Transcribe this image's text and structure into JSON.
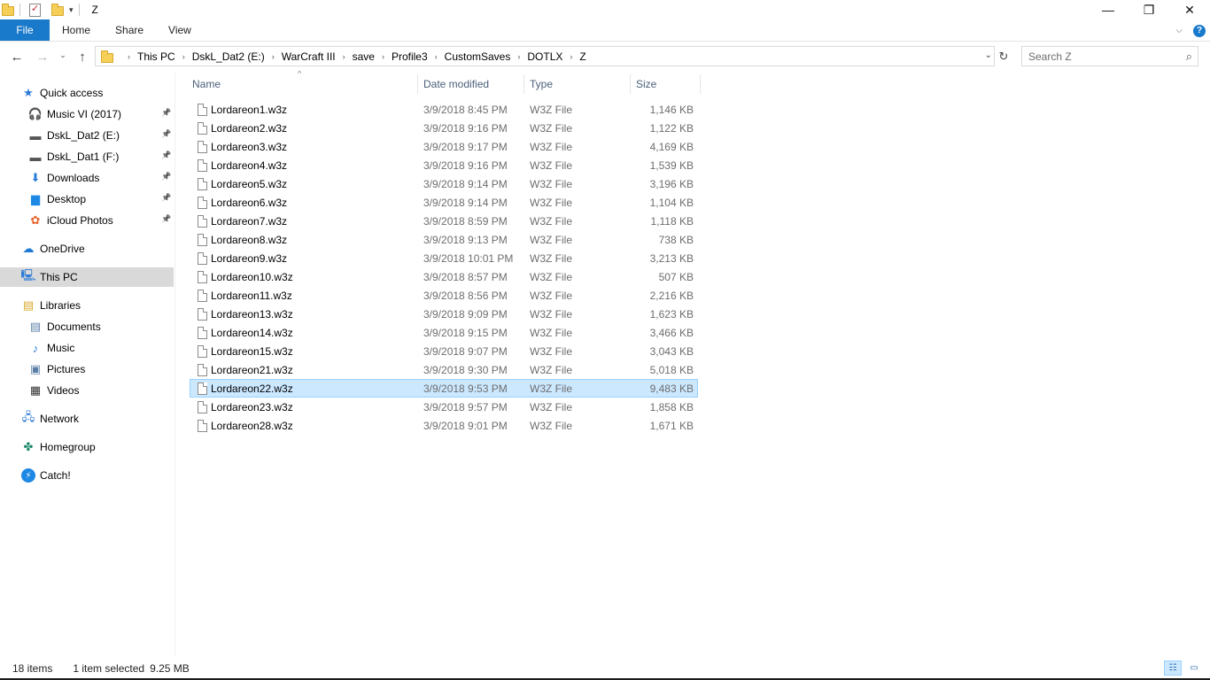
{
  "window": {
    "title": "Z",
    "minimize_glyph": "—",
    "maximize_glyph": "❐",
    "close_glyph": "✕"
  },
  "ribbon": {
    "tabs": [
      "File",
      "Home",
      "Share",
      "View"
    ],
    "expand_glyph": "⌵",
    "help_glyph": "?"
  },
  "navigation": {
    "back_glyph": "←",
    "forward_glyph": "→",
    "recent_glyph": "⌄",
    "up_glyph": "↑",
    "refresh_glyph": "↻",
    "dropdown_glyph": "⌄",
    "breadcrumbs": [
      "This PC",
      "DskL_Dat2 (E:)",
      "WarCraft III",
      "save",
      "Profile3",
      "CustomSaves",
      "DOTLX",
      "Z"
    ],
    "search_placeholder": "Search Z",
    "search_icon": "magnifier-icon"
  },
  "sidebar": {
    "items": [
      {
        "label": "Quick access",
        "icon": "star-icon",
        "glyph": "★",
        "color": "#2d7bd8"
      },
      {
        "label": "Music VI (2017)",
        "icon": "headphones-icon",
        "glyph": "🎧",
        "color": "#d2245a",
        "pinned": true
      },
      {
        "label": "DskL_Dat2 (E:)",
        "icon": "drive-icon",
        "glyph": "▬",
        "color": "#555555",
        "pinned": true
      },
      {
        "label": "DskL_Dat1 (F:)",
        "icon": "drive-icon",
        "glyph": "▬",
        "color": "#555555",
        "pinned": true
      },
      {
        "label": "Downloads",
        "icon": "download-arrow-icon",
        "glyph": "⬇",
        "color": "#2d7bd8",
        "pinned": true
      },
      {
        "label": "Desktop",
        "icon": "desktop-icon",
        "glyph": "▆",
        "color": "#1e88e5",
        "pinned": true
      },
      {
        "label": "iCloud Photos",
        "icon": "photos-icon",
        "glyph": "✿",
        "color": "#e8622c",
        "pinned": true
      },
      {
        "label": "OneDrive",
        "icon": "cloud-icon",
        "glyph": "☁",
        "color": "#1d78d6"
      },
      {
        "label": "This PC",
        "icon": "computer-icon",
        "glyph": "🖳",
        "color": "#2d7bd8",
        "selected": true
      },
      {
        "label": "Libraries",
        "icon": "libraries-icon",
        "glyph": "▤",
        "color": "#d9a92d"
      },
      {
        "label": "Documents",
        "icon": "documents-icon",
        "glyph": "▤",
        "color": "#5a7fa8"
      },
      {
        "label": "Music",
        "icon": "music-note-icon",
        "glyph": "♪",
        "color": "#2d7bd8"
      },
      {
        "label": "Pictures",
        "icon": "pictures-icon",
        "glyph": "▣",
        "color": "#5a7fa8"
      },
      {
        "label": "Videos",
        "icon": "film-icon",
        "glyph": "▦",
        "color": "#333333"
      },
      {
        "label": "Network",
        "icon": "network-icon",
        "glyph": "🖧",
        "color": "#2d7bd8"
      },
      {
        "label": "Homegroup",
        "icon": "homegroup-icon",
        "glyph": "✤",
        "color": "#1a8a6a"
      },
      {
        "label": "Catch!",
        "icon": "lightning-icon",
        "glyph": "⚡",
        "color": "#ffffff",
        "bg": "#1e88e5"
      }
    ],
    "pin_glyph": "📌"
  },
  "file_list": {
    "columns": [
      "Name",
      "Date modified",
      "Type",
      "Size"
    ],
    "sort_glyph": "^",
    "rows": [
      {
        "name": "Lordareon1.w3z",
        "date": "3/9/2018 8:45 PM",
        "type": "W3Z File",
        "size": "1,146 KB"
      },
      {
        "name": "Lordareon2.w3z",
        "date": "3/9/2018 9:16 PM",
        "type": "W3Z File",
        "size": "1,122 KB"
      },
      {
        "name": "Lordareon3.w3z",
        "date": "3/9/2018 9:17 PM",
        "type": "W3Z File",
        "size": "4,169 KB"
      },
      {
        "name": "Lordareon4.w3z",
        "date": "3/9/2018 9:16 PM",
        "type": "W3Z File",
        "size": "1,539 KB"
      },
      {
        "name": "Lordareon5.w3z",
        "date": "3/9/2018 9:14 PM",
        "type": "W3Z File",
        "size": "3,196 KB"
      },
      {
        "name": "Lordareon6.w3z",
        "date": "3/9/2018 9:14 PM",
        "type": "W3Z File",
        "size": "1,104 KB"
      },
      {
        "name": "Lordareon7.w3z",
        "date": "3/9/2018 8:59 PM",
        "type": "W3Z File",
        "size": "1,118 KB"
      },
      {
        "name": "Lordareon8.w3z",
        "date": "3/9/2018 9:13 PM",
        "type": "W3Z File",
        "size": "738 KB"
      },
      {
        "name": "Lordareon9.w3z",
        "date": "3/9/2018 10:01 PM",
        "type": "W3Z File",
        "size": "3,213 KB"
      },
      {
        "name": "Lordareon10.w3z",
        "date": "3/9/2018 8:57 PM",
        "type": "W3Z File",
        "size": "507 KB"
      },
      {
        "name": "Lordareon11.w3z",
        "date": "3/9/2018 8:56 PM",
        "type": "W3Z File",
        "size": "2,216 KB"
      },
      {
        "name": "Lordareon13.w3z",
        "date": "3/9/2018 9:09 PM",
        "type": "W3Z File",
        "size": "1,623 KB"
      },
      {
        "name": "Lordareon14.w3z",
        "date": "3/9/2018 9:15 PM",
        "type": "W3Z File",
        "size": "3,466 KB"
      },
      {
        "name": "Lordareon15.w3z",
        "date": "3/9/2018 9:07 PM",
        "type": "W3Z File",
        "size": "3,043 KB"
      },
      {
        "name": "Lordareon21.w3z",
        "date": "3/9/2018 9:30 PM",
        "type": "W3Z File",
        "size": "5,018 KB"
      },
      {
        "name": "Lordareon22.w3z",
        "date": "3/9/2018 9:53 PM",
        "type": "W3Z File",
        "size": "9,483 KB",
        "selected": true
      },
      {
        "name": "Lordareon23.w3z",
        "date": "3/9/2018 9:57 PM",
        "type": "W3Z File",
        "size": "1,858 KB"
      },
      {
        "name": "Lordareon28.w3z",
        "date": "3/9/2018 9:01 PM",
        "type": "W3Z File",
        "size": "1,671 KB"
      }
    ]
  },
  "status_bar": {
    "item_count": "18 items",
    "selection": "1 item selected",
    "selection_size": "9.25 MB",
    "details_view_glyph": "☷",
    "tiles_view_glyph": "▭"
  },
  "colors": {
    "accent": "#1979ca",
    "selection_bg": "#cce8ff",
    "selection_border": "#99d1ff",
    "header_text": "#4c607a"
  }
}
